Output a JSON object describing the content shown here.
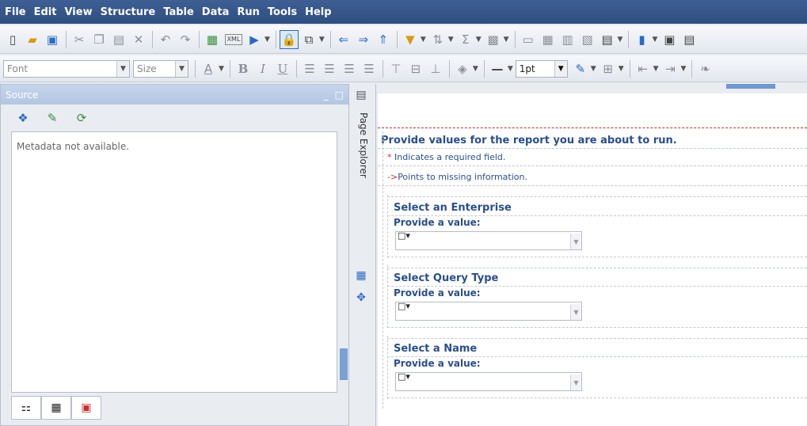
{
  "menu": [
    "File",
    "Edit",
    "View",
    "Structure",
    "Table",
    "Data",
    "Run",
    "Tools",
    "Help"
  ],
  "toolbar_font": {
    "font_placeholder": "Font",
    "size_placeholder": "Size",
    "line_weight": "1pt"
  },
  "source_panel": {
    "title": "Source",
    "message": "Metadata not available."
  },
  "page_explorer_label": "Page Explorer",
  "prompt_page": {
    "header": "Provide values for the report you are about to run.",
    "required_note": "Indicates a required field.",
    "required_symbol": "*",
    "missing_note": "Points to missing information.",
    "missing_symbol": "->",
    "sections": [
      {
        "title": "Select an Enterprise",
        "label": "Provide a value:"
      },
      {
        "title": "Select Query Type",
        "label": "Provide a value:"
      },
      {
        "title": "Select a Name",
        "label": "Provide a value:"
      }
    ]
  }
}
